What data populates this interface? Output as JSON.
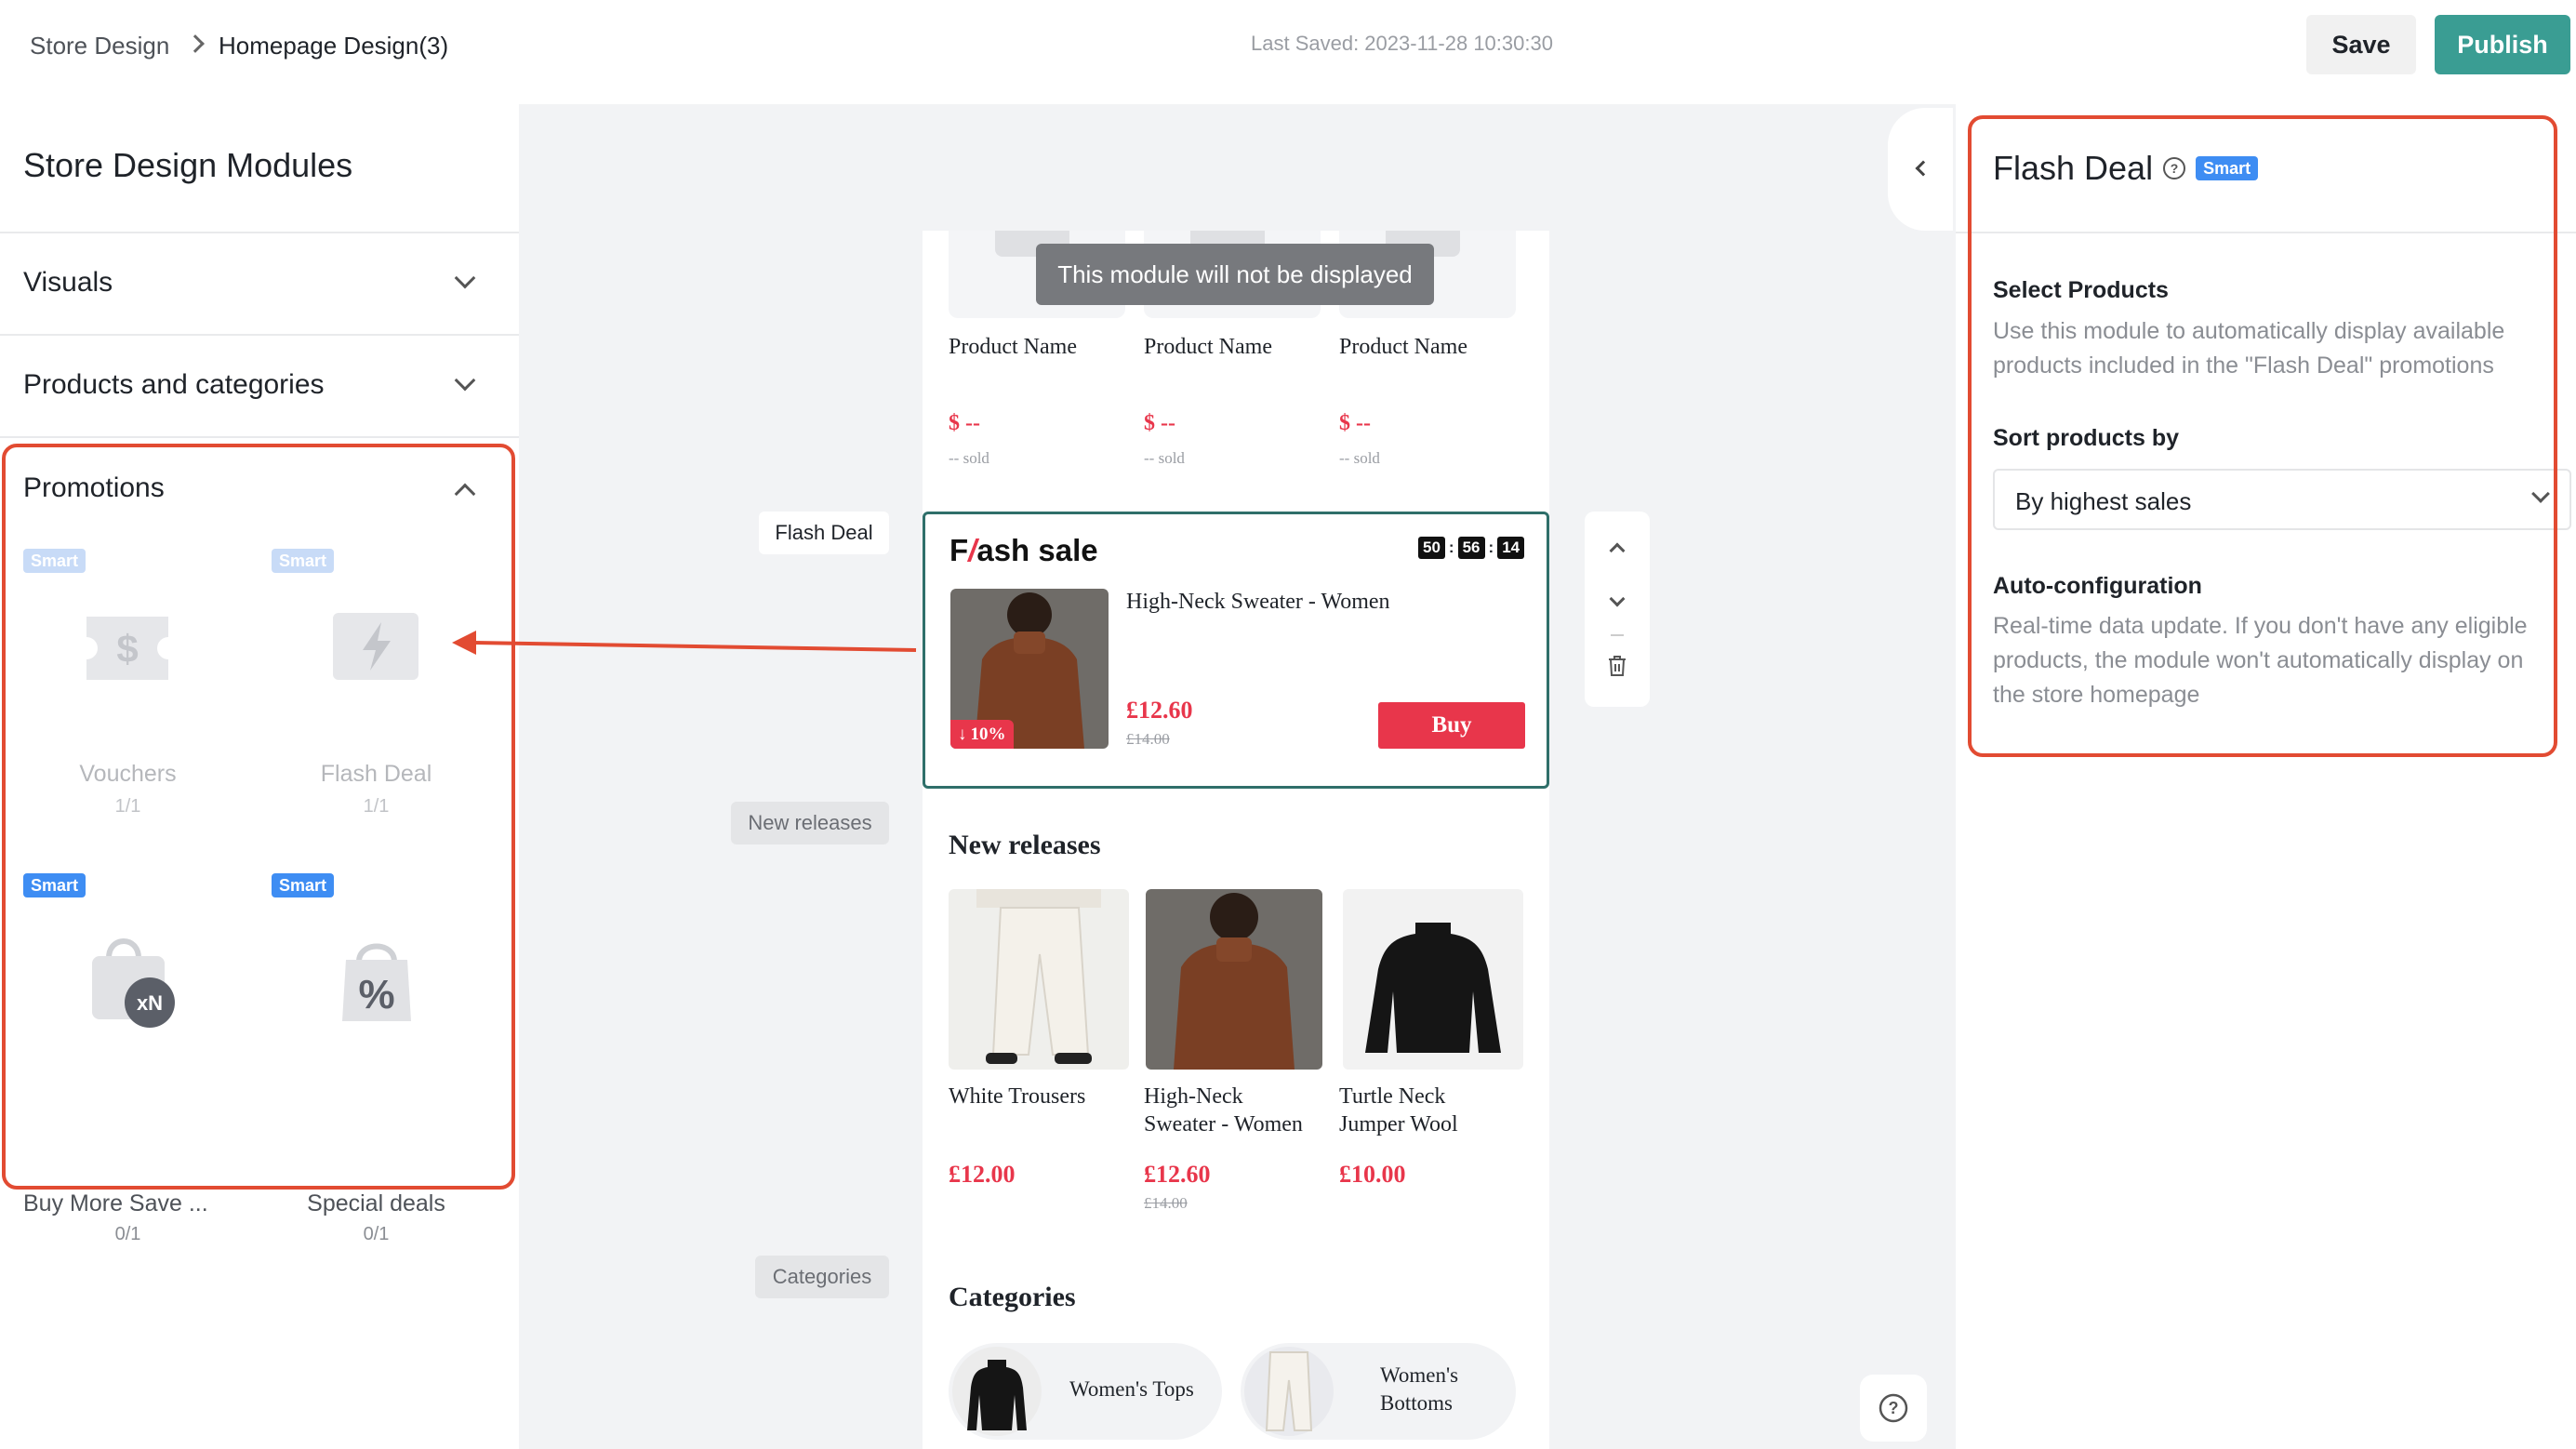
{
  "breadcrumb": {
    "root": "Store Design",
    "current": "Homepage Design(3)"
  },
  "last_saved": "Last Saved: 2023-11-28 10:30:30",
  "toolbar": {
    "save_label": "Save",
    "publish_label": "Publish"
  },
  "left_panel": {
    "title": "Store Design Modules",
    "sections": {
      "visuals": "Visuals",
      "products": "Products and categories",
      "promotions": "Promotions"
    },
    "smart_label": "Smart",
    "modules": [
      {
        "name": "Vouchers",
        "count": "1/1",
        "icon": "dollar-ticket-icon"
      },
      {
        "name": "Flash Deal",
        "count": "1/1",
        "icon": "lightning-icon"
      },
      {
        "name": "Buy More Save ...",
        "count": "0/1",
        "icon": "shopping-bag-xn-icon",
        "badge": "xN"
      },
      {
        "name": "Special deals",
        "count": "0/1",
        "icon": "percent-bag-icon",
        "badge": "%"
      }
    ]
  },
  "canvas": {
    "hidden_notice": "This module will not be displayed",
    "product_placeholders": [
      {
        "name": "Product Name",
        "price": "$ --",
        "sold": "-- sold"
      },
      {
        "name": "Product Name",
        "price": "$ --",
        "sold": "-- sold"
      },
      {
        "name": "Product Name",
        "price": "$ --",
        "sold": "-- sold"
      }
    ],
    "labels": {
      "flash_deal": "Flash Deal",
      "new_releases": "New releases",
      "categories": "Categories"
    },
    "flash": {
      "title_f": "F",
      "title_rest": "ash sale",
      "timer": [
        "50",
        "56",
        "14"
      ],
      "product_name": "High-Neck Sweater - Women",
      "price": "£12.60",
      "old_price": "£14.00",
      "discount": "10%",
      "buy_label": "Buy"
    },
    "new_releases": {
      "title": "New releases",
      "items": [
        {
          "name_line1": "White Trousers",
          "name_line2": "",
          "price": "£12.00",
          "old_price": ""
        },
        {
          "name_line1": "High-Neck",
          "name_line2": "Sweater - Women",
          "price": "£12.60",
          "old_price": "£14.00"
        },
        {
          "name_line1": "Turtle Neck",
          "name_line2": "Jumper Wool",
          "price": "£10.00",
          "old_price": ""
        }
      ]
    },
    "categories": {
      "title": "Categories",
      "items": [
        {
          "line1": "Women's Tops",
          "line2": ""
        },
        {
          "line1": "Women's",
          "line2": "Bottoms"
        }
      ]
    }
  },
  "right_panel": {
    "title": "Flash Deal",
    "smart_label": "Smart",
    "select_heading": "Select Products",
    "select_desc_1": "Use this module to automatically display available",
    "select_desc_2": "products included in the \"Flash Deal\" promotions",
    "sort_heading": "Sort products by",
    "sort_value": "By highest sales",
    "auto_heading": "Auto-configuration",
    "auto_desc_1": "Real-time data update. If you don't have any eligible",
    "auto_desc_2": "products, the module won't automatically display on",
    "auto_desc_3": "the store homepage"
  },
  "colors": {
    "accent": "#3a9d93",
    "price_red": "#e8364b",
    "annotation_red": "#e24b32",
    "smart_blue": "#3e8df3"
  }
}
